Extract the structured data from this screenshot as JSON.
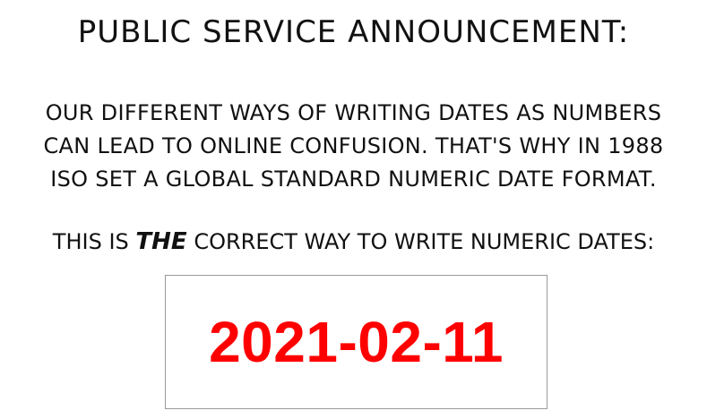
{
  "announcement": {
    "title": "PUBLIC SERVICE ANNOUNCEMENT:",
    "body_lines": [
      "OUR DIFFERENT WAYS OF WRITING DATES AS NUMBERS",
      "CAN LEAD TO ONLINE CONFUSION. THAT'S WHY IN 1988",
      "ISO SET A GLOBAL STANDARD NUMERIC DATE FORMAT."
    ],
    "correct_prefix": "THIS IS",
    "correct_emphasis": "THE",
    "correct_suffix": "CORRECT WAY TO WRITE NUMERIC DATES:",
    "date_value": "2021-02-11"
  },
  "colors": {
    "date_text": "#ff0000",
    "text": "#111111",
    "box_border": "#9a9a9a"
  }
}
